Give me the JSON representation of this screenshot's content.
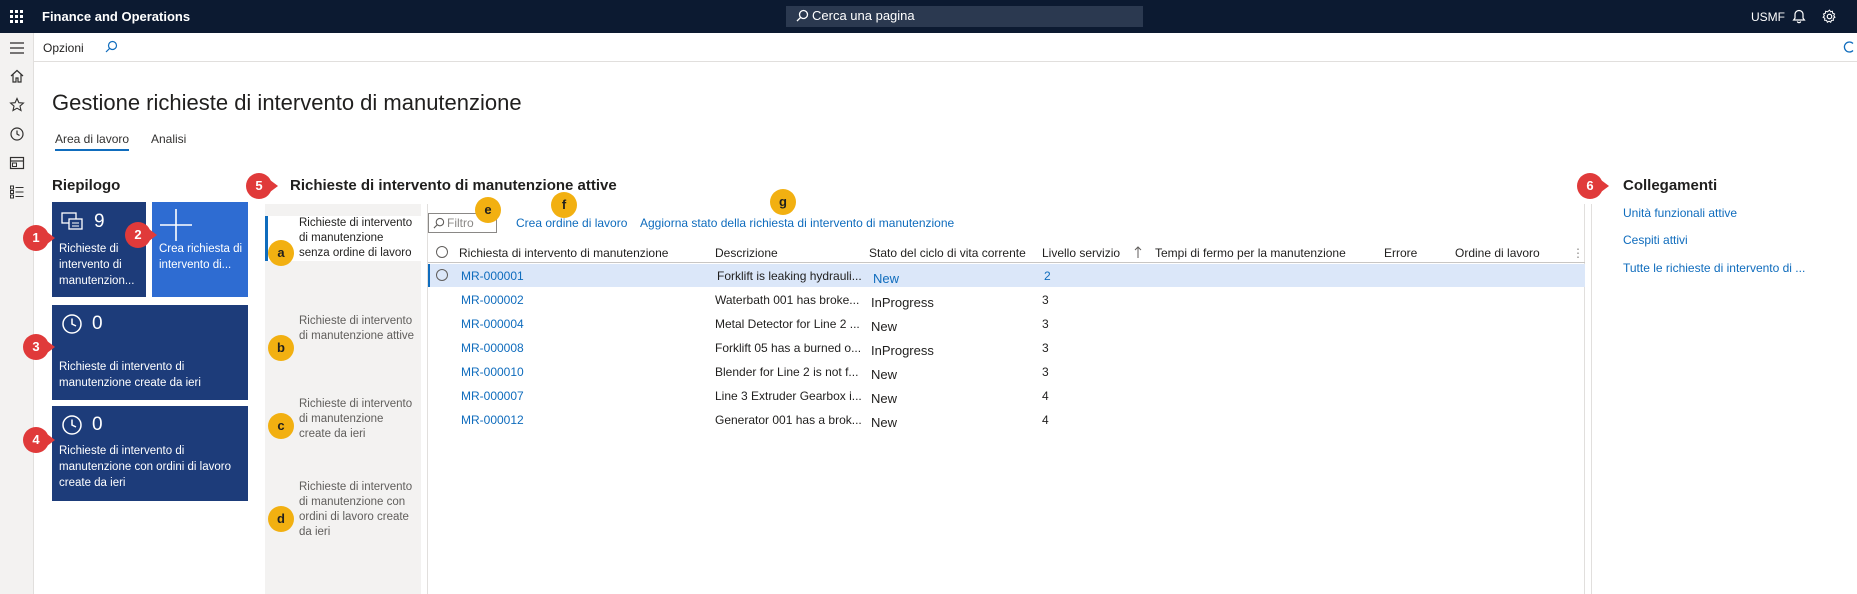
{
  "topbar": {
    "app_title": "Finance and Operations",
    "search_placeholder": "Cerca una pagina",
    "company": "USMF"
  },
  "actionbar": {
    "options_label": "Opzioni"
  },
  "page": {
    "title": "Gestione richieste di intervento di manutenzione",
    "tabs": [
      "Area di lavoro",
      "Analisi"
    ]
  },
  "summary": {
    "heading": "Riepilogo",
    "tiles": [
      {
        "count": "9",
        "label": "Richieste di intervento di manutenzion..."
      },
      {
        "count": "",
        "label": "Crea richiesta di intervento di..."
      },
      {
        "count": "0",
        "label": "Richieste di intervento di manutenzione create da ieri"
      },
      {
        "count": "0",
        "label": "Richieste di intervento di manutenzione con ordini di lavoro create da ieri"
      }
    ]
  },
  "active": {
    "heading": "Richieste di intervento di manutenzione attive",
    "vtabs": [
      "Richieste di intervento di manutenzione senza ordine di lavoro",
      "Richieste di intervento di manutenzione attive",
      "Richieste di intervento di manutenzione create da ieri",
      "Richieste di intervento di manutenzione con ordini di lavoro create da ieri"
    ],
    "filter_placeholder": "Filtro",
    "commands": [
      "Crea ordine di lavoro",
      "Aggiorna stato della richiesta di intervento di manutenzione"
    ],
    "columns": [
      "Richiesta di intervento di manutenzione",
      "Descrizione",
      "Stato del ciclo di vita corrente",
      "Livello servizio",
      "Tempi di fermo per la manutenzione",
      "Errore",
      "Ordine di lavoro"
    ],
    "rows": [
      {
        "id": "MR-000001",
        "desc": "Forklift is leaking hydrauli...",
        "status": "New",
        "level": "2"
      },
      {
        "id": "MR-000002",
        "desc": "Waterbath 001 has broke...",
        "status": "InProgress",
        "level": "3"
      },
      {
        "id": "MR-000004",
        "desc": "Metal Detector for Line 2 ...",
        "status": "New",
        "level": "3"
      },
      {
        "id": "MR-000008",
        "desc": "Forklift 05 has a burned o...",
        "status": "InProgress",
        "level": "3"
      },
      {
        "id": "MR-000010",
        "desc": "Blender for Line 2 is not f...",
        "status": "New",
        "level": "3"
      },
      {
        "id": "MR-000007",
        "desc": "Line 3 Extruder Gearbox i...",
        "status": "New",
        "level": "4"
      },
      {
        "id": "MR-000012",
        "desc": "Generator 001 has a brok...",
        "status": "New",
        "level": "4"
      }
    ]
  },
  "links": {
    "heading": "Collegamenti",
    "items": [
      "Unità funzionali attive",
      "Cespiti attivi",
      "Tutte le richieste di intervento di ..."
    ]
  },
  "badges": {
    "red": [
      "1",
      "2",
      "3",
      "4",
      "5",
      "6"
    ],
    "yellow": [
      "a",
      "b",
      "c",
      "d",
      "e",
      "f",
      "g"
    ]
  },
  "colors": {
    "topbar": "#0c1a31",
    "tile": "#1d3c7a",
    "tile_light": "#2e6cd2",
    "accent": "#0f6cbd",
    "badge_red": "#e03a3a",
    "badge_yellow": "#f2b011"
  }
}
